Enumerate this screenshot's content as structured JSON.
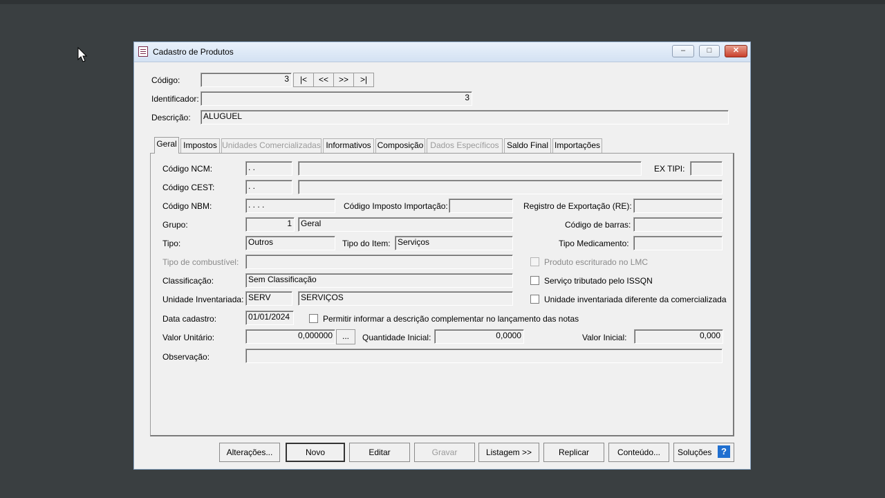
{
  "window": {
    "title": "Cadastro de Produtos",
    "controls": {
      "minimize": "–",
      "maximize": "□",
      "close": "✕"
    }
  },
  "header": {
    "codigo_label": "Código:",
    "codigo_value": "3",
    "nav": [
      "|<",
      "<<",
      ">>",
      ">|"
    ],
    "identificador_label": "Identificador:",
    "identificador_value": "3",
    "descricao_label": "Descrição:",
    "descricao_value": "ALUGUEL"
  },
  "tabs": [
    {
      "label": "Geral",
      "active": true,
      "enabled": true
    },
    {
      "label": "Impostos",
      "enabled": true
    },
    {
      "label": "Unidades Comercializadas",
      "enabled": false
    },
    {
      "label": "Informativos",
      "enabled": true
    },
    {
      "label": "Composição",
      "enabled": true
    },
    {
      "label": "Dados Específicos",
      "enabled": false
    },
    {
      "label": "Saldo Final",
      "enabled": true
    },
    {
      "label": "Importações",
      "enabled": true
    }
  ],
  "geral": {
    "ncm_label": "Código NCM:",
    "ncm_value": " . .",
    "ncm_desc": "",
    "extipi_label": "EX TIPI:",
    "extipi_value": "",
    "cest_label": "Código CEST:",
    "cest_value": " .  .",
    "cest_desc": "",
    "nbm_label": "Código NBM:",
    "nbm_value": " .  .  .  .",
    "imp_import_label": "Código Imposto Importação:",
    "imp_import_value": "",
    "reg_export_label": "Registro de Exportação (RE):",
    "reg_export_value": "",
    "grupo_label": "Grupo:",
    "grupo_code": "1",
    "grupo_name": "Geral",
    "barras_label": "Código de barras:",
    "barras_value": "",
    "tipo_label": "Tipo:",
    "tipo_value": "Outros",
    "tipo_item_label": "Tipo do Item:",
    "tipo_item_value": "Serviços",
    "tipo_med_label": "Tipo Medicamento:",
    "tipo_med_value": "",
    "combustivel_label": "Tipo de combustível:",
    "combustivel_value": "",
    "lmc_label": "Produto escriturado no LMC",
    "classificacao_label": "Classificação:",
    "classificacao_value": "Sem Classificação",
    "issqn_label": "Serviço tributado pelo ISSQN",
    "unid_label": "Unidade Inventariada:",
    "unid_code": "SERV",
    "unid_name": "SERVIÇOS",
    "unid_diff_label": "Unidade inventariada diferente da comercializada",
    "data_label": "Data cadastro:",
    "data_value": "01/01/2024",
    "permitir_label": "Permitir informar a descrição complementar no lançamento das notas",
    "valor_unit_label": "Valor Unitário:",
    "valor_unit_value": "0,000000",
    "ellipsis": "...",
    "qtd_label": "Quantidade Inicial:",
    "qtd_value": "0,0000",
    "valor_inicial_label": "Valor Inicial:",
    "valor_inicial_value": "0,000",
    "obs_label": "Observação:",
    "obs_value": ""
  },
  "footer": {
    "alteracoes": "Alterações...",
    "novo": "Novo",
    "editar": "Editar",
    "gravar": "Gravar",
    "listagem": "Listagem >>",
    "replicar": "Replicar",
    "conteudo": "Conteúdo...",
    "solucoes": "Soluções",
    "help": "?"
  }
}
